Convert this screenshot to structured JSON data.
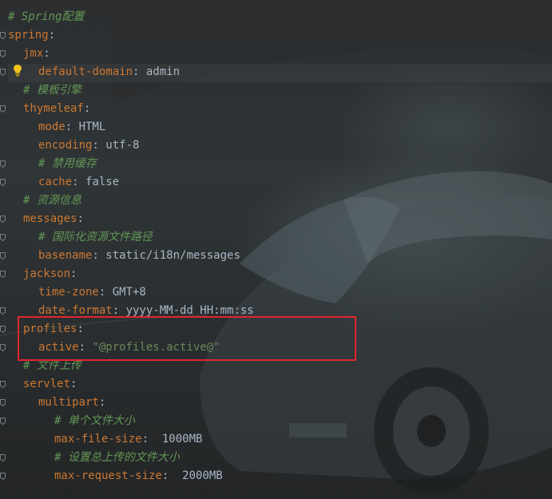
{
  "editor": {
    "lines": [
      {
        "comment": "# Spring配置"
      },
      {
        "key": "spring",
        "sep": ":"
      },
      {
        "key": "jmx",
        "sep": ":"
      },
      {
        "key": "default-domain",
        "sep": ": ",
        "value": "admin"
      },
      {
        "comment": "# 模板引擎"
      },
      {
        "key": "thymeleaf",
        "sep": ":"
      },
      {
        "key": "mode",
        "sep": ": ",
        "value": "HTML"
      },
      {
        "key": "encoding",
        "sep": ": ",
        "value": "utf-8"
      },
      {
        "comment": "# 禁用缓存"
      },
      {
        "key": "cache",
        "sep": ": ",
        "value": "false"
      },
      {
        "comment": "# 资源信息"
      },
      {
        "key": "messages",
        "sep": ":"
      },
      {
        "comment": "# 国际化资源文件路径"
      },
      {
        "key": "basename",
        "sep": ": ",
        "value": "static/i18n/messages"
      },
      {
        "key": "jackson",
        "sep": ":"
      },
      {
        "key": "time-zone",
        "sep": ": ",
        "value": "GMT+8"
      },
      {
        "key": "date-format",
        "sep": ": ",
        "value": "yyyy-MM-dd HH:mm:ss"
      },
      {
        "key": "profiles",
        "sep": ":"
      },
      {
        "key": "active",
        "sep": ": ",
        "value": "\"@profiles.active@\""
      },
      {
        "comment": "# 文件上传"
      },
      {
        "key": "servlet",
        "sep": ":"
      },
      {
        "key": "multipart",
        "sep": ":"
      },
      {
        "comment": "# 单个文件大小"
      },
      {
        "key": "max-file-size",
        "sep": ":  ",
        "value": "1000MB"
      },
      {
        "comment": "# 设置总上传的文件大小"
      },
      {
        "key": "max-request-size",
        "sep": ":  ",
        "value": "2000MB"
      }
    ]
  },
  "colors": {
    "key": "#cc7832",
    "value": "#a9b7c6",
    "comment": "#629755",
    "string": "#6a8759",
    "highlight_box": "#e4242e",
    "intention_bulb": "#f0c419"
  },
  "icons": {
    "intention": "lightbulb-icon",
    "fold": "fold-marker-icon"
  }
}
